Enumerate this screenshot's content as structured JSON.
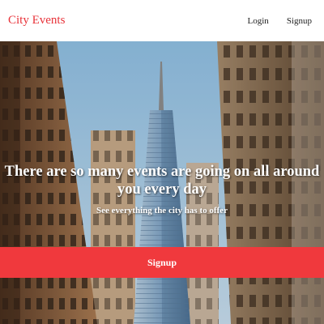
{
  "header": {
    "brand": "City Events",
    "links": [
      {
        "label": "Login"
      },
      {
        "label": "Signup"
      }
    ]
  },
  "hero": {
    "heading_line1": "There are so many events are going on all around",
    "heading_line2": "you every day",
    "subheading": "See everything the city has to offer",
    "cta_label": "Signup",
    "background_description_icon": "city-skyline-photo"
  },
  "colors": {
    "brand": "#e8333a",
    "cta": "#f0393d",
    "sky": "#9cc6e4"
  }
}
